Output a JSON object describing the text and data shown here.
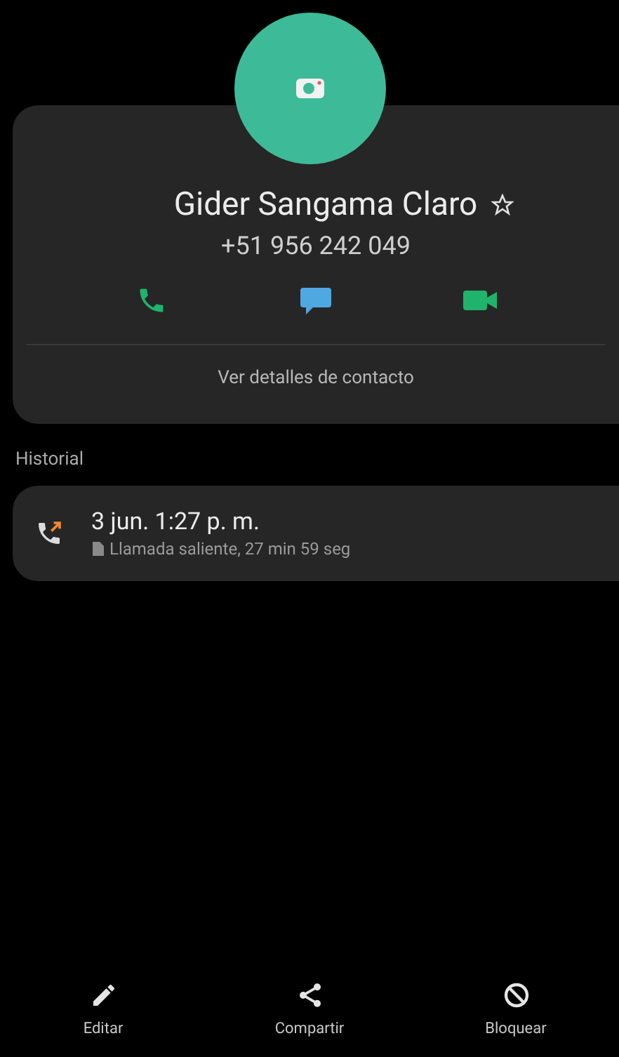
{
  "contact": {
    "name": "Gider Sangama Claro",
    "favorite": false,
    "phone": "+51 956 242 049",
    "actions": [
      {
        "kind": "call"
      },
      {
        "kind": "message"
      },
      {
        "kind": "video"
      }
    ],
    "details_link": "Ver detalles de contacto"
  },
  "history": {
    "title": "Historial",
    "entries": [
      {
        "time": "3 jun. 1:27 p. m.",
        "detail": "Llamada saliente, 27 min 59 seg"
      }
    ]
  },
  "bottom_bar": [
    {
      "kind": "edit",
      "label": "Editar"
    },
    {
      "kind": "share",
      "label": "Compartir"
    },
    {
      "kind": "block",
      "label": "Bloquear"
    }
  ]
}
